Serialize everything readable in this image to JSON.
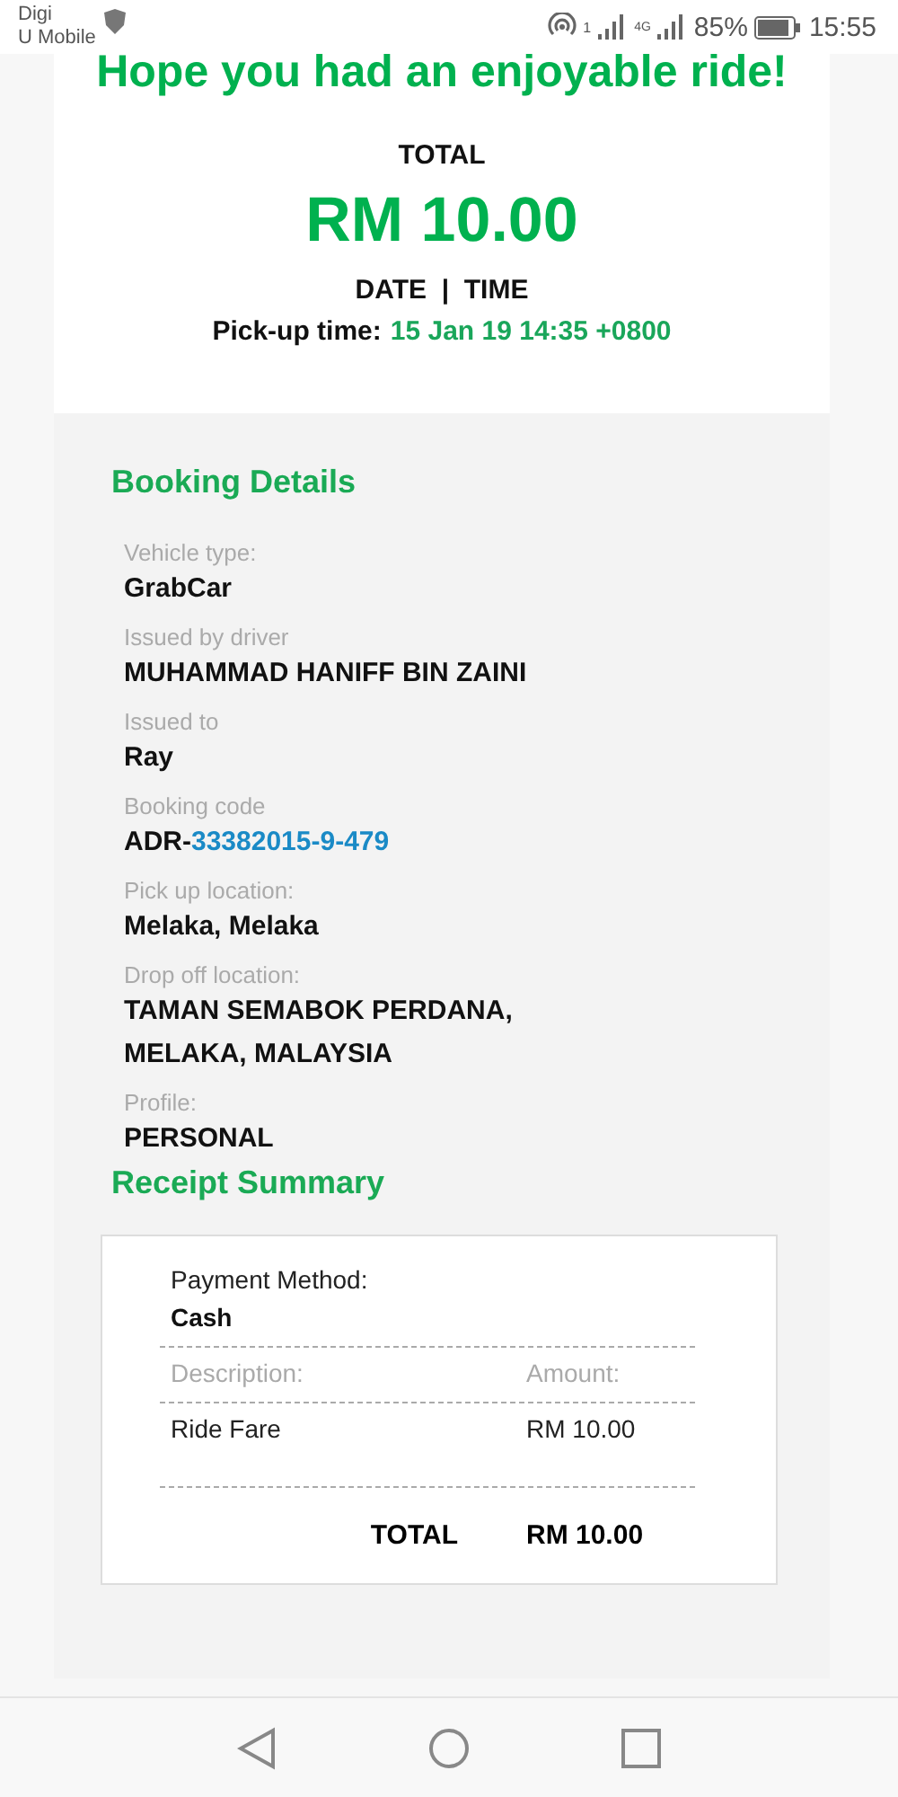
{
  "status_bar": {
    "carrier_1": "Digi",
    "carrier_2": "U Mobile",
    "hotspot_sup": "1",
    "network_label": "4G",
    "battery": "85%",
    "time": "15:55"
  },
  "header": {
    "headline": "Hope you had an enjoyable ride!",
    "total_label": "TOTAL",
    "total_amount": "RM 10.00",
    "date_time_label": "DATE  |  TIME",
    "pickup_label": "Pick-up time:",
    "pickup_value": "15 Jan 19 14:35 +0800"
  },
  "booking_details": {
    "title": "Booking Details",
    "fields": [
      {
        "kind": "text",
        "label": "Vehicle type:",
        "value": "GrabCar"
      },
      {
        "kind": "text",
        "label": "Issued by driver",
        "value": "MUHAMMAD HANIFF BIN ZAINI"
      },
      {
        "kind": "text",
        "label": "Issued to",
        "value": "Ray"
      },
      {
        "kind": "code",
        "label": "Booking code",
        "prefix": "ADR-",
        "link": "33382015-9-479"
      },
      {
        "kind": "text",
        "label": "Pick up location:",
        "value": "Melaka, Melaka"
      },
      {
        "kind": "lines",
        "label": "Drop off location:",
        "lines": [
          "TAMAN SEMABOK PERDANA,",
          "MELAKA, MALAYSIA"
        ]
      },
      {
        "kind": "text",
        "label": "Profile:",
        "value": "PERSONAL"
      }
    ]
  },
  "receipt_summary": {
    "title": "Receipt Summary",
    "payment_label": "Payment Method:",
    "payment_value": "Cash",
    "columns": [
      "Description:",
      "Amount:"
    ],
    "items": [
      {
        "description": "Ride Fare",
        "amount": "RM 10.00"
      }
    ],
    "total_label": "TOTAL",
    "total_value": "RM 10.00"
  }
}
